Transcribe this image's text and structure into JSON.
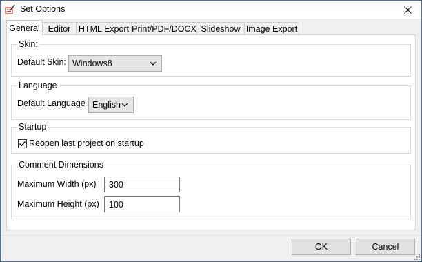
{
  "window": {
    "title": "Set Options"
  },
  "tabs": [
    {
      "label": "General",
      "active": true
    },
    {
      "label": "Editor"
    },
    {
      "label": "HTML Export"
    },
    {
      "label": "Print/PDF/DOCX"
    },
    {
      "label": "Slideshow"
    },
    {
      "label": "Image Export"
    }
  ],
  "skin": {
    "group_label": "Skin:",
    "field_label": "Default Skin:",
    "value": "Windows8"
  },
  "language": {
    "group_label": "Language",
    "field_label": "Default Language",
    "value": "English"
  },
  "startup": {
    "group_label": "Startup",
    "checkbox_label": "Reopen last project on startup",
    "checked": true
  },
  "comment": {
    "group_label": "Comment Dimensions",
    "width_label": "Maximum Width (px)",
    "width_value": "300",
    "height_label": "Maximum Height (px)",
    "height_value": "100"
  },
  "buttons": {
    "ok": "OK",
    "cancel": "Cancel"
  },
  "colors": {
    "window_border": "#4a6fa5",
    "icon_red": "#d9322c",
    "background": "#f0f0f0"
  }
}
